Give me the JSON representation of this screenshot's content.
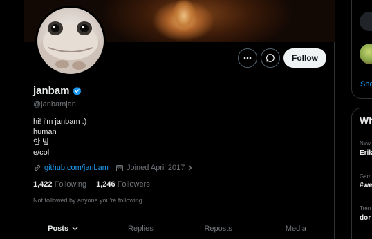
{
  "profile": {
    "display_name": "janbam",
    "handle": "@janbamjan",
    "bio_lines": [
      "hi! i'm janbam :)",
      "human",
      "안 밤",
      "e/coll"
    ],
    "website": "github.com/janbam",
    "joined": "Joined April 2017",
    "following_count": "1,422",
    "following_label": "Following",
    "followers_count": "1,246",
    "followers_label": "Followers",
    "followed_note": "Not followed by anyone you're following"
  },
  "actions": {
    "follow_label": "Follow",
    "more_icon": "more-icon",
    "message_icon": "message-icon"
  },
  "tabs": [
    {
      "label": "Posts",
      "active": true
    },
    {
      "label": "Replies",
      "active": false
    },
    {
      "label": "Reposts",
      "active": false
    },
    {
      "label": "Media",
      "active": false
    }
  ],
  "sidebar": {
    "show_more": "Sho",
    "trends_heading": "Wh",
    "trends": [
      {
        "meta": "New",
        "title": "Erik"
      },
      {
        "meta": "Gam",
        "title": "#we"
      },
      {
        "meta": "Tren",
        "title": "dor"
      }
    ]
  },
  "colors": {
    "accent": "#1d9bf0",
    "background": "#000000",
    "text_primary": "#e7e9ea",
    "text_secondary": "#71767b",
    "border": "#2f3336"
  }
}
